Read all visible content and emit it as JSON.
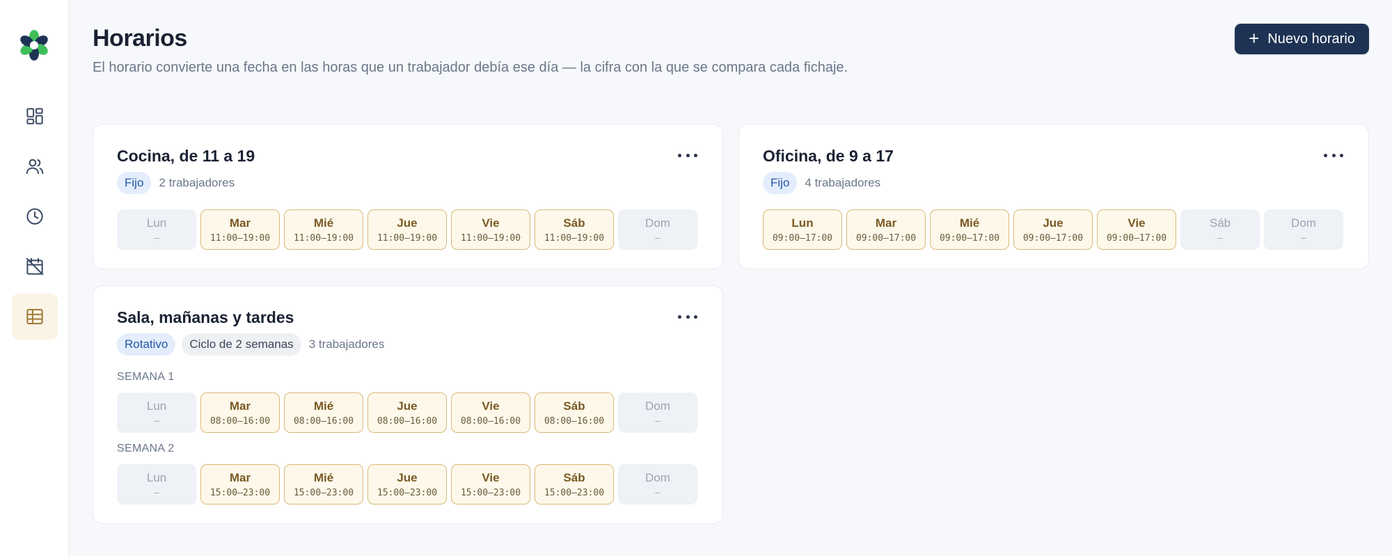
{
  "header": {
    "title": "Horarios",
    "subtitle": "El horario convierte una fecha en las horas que un trabajador debía ese día — la cifra con la que se compara cada fichaje.",
    "new_button": "Nuevo horario",
    "new_button_plus": "+"
  },
  "sidebar": {
    "items": [
      {
        "icon": "dashboard-icon",
        "active": false
      },
      {
        "icon": "users-icon",
        "active": false
      },
      {
        "icon": "clock-icon",
        "active": false
      },
      {
        "icon": "calendar-off-icon",
        "active": false
      },
      {
        "icon": "table-icon",
        "active": true
      }
    ]
  },
  "colors": {
    "accent": "#1e3354",
    "logo_green": "#3fbf5a",
    "logo_dark": "#1e3354",
    "day_on_border": "#d9b878",
    "day_on_bg": "#fdf8ea"
  },
  "schedules": [
    {
      "title": "Cocina, de 11 a 19",
      "type": "Fijo",
      "workers": "2 trabajadores",
      "days": [
        {
          "name": "Lun",
          "time": "–"
        },
        {
          "name": "Mar",
          "time": "11:00–19:00"
        },
        {
          "name": "Mié",
          "time": "11:00–19:00"
        },
        {
          "name": "Jue",
          "time": "11:00–19:00"
        },
        {
          "name": "Vie",
          "time": "11:00–19:00"
        },
        {
          "name": "Sáb",
          "time": "11:00–19:00"
        },
        {
          "name": "Dom",
          "time": "–"
        }
      ]
    },
    {
      "title": "Oficina, de 9 a 17",
      "type": "Fijo",
      "workers": "4 trabajadores",
      "days": [
        {
          "name": "Lun",
          "time": "09:00–17:00"
        },
        {
          "name": "Mar",
          "time": "09:00–17:00"
        },
        {
          "name": "Mié",
          "time": "09:00–17:00"
        },
        {
          "name": "Jue",
          "time": "09:00–17:00"
        },
        {
          "name": "Vie",
          "time": "09:00–17:00"
        },
        {
          "name": "Sáb",
          "time": "–"
        },
        {
          "name": "Dom",
          "time": "–"
        }
      ]
    },
    {
      "title": "Sala, mañanas y tardes",
      "type": "Rotativo",
      "cycle": "Ciclo de 2 semanas",
      "workers": "3 trabajadores",
      "weeks": [
        {
          "label": "SEMANA 1",
          "days": [
            {
              "name": "Lun",
              "time": "–"
            },
            {
              "name": "Mar",
              "time": "08:00–16:00"
            },
            {
              "name": "Mié",
              "time": "08:00–16:00"
            },
            {
              "name": "Jue",
              "time": "08:00–16:00"
            },
            {
              "name": "Vie",
              "time": "08:00–16:00"
            },
            {
              "name": "Sáb",
              "time": "08:00–16:00"
            },
            {
              "name": "Dom",
              "time": "–"
            }
          ]
        },
        {
          "label": "SEMANA 2",
          "days": [
            {
              "name": "Lun",
              "time": "–"
            },
            {
              "name": "Mar",
              "time": "15:00–23:00"
            },
            {
              "name": "Mié",
              "time": "15:00–23:00"
            },
            {
              "name": "Jue",
              "time": "15:00–23:00"
            },
            {
              "name": "Vie",
              "time": "15:00–23:00"
            },
            {
              "name": "Sáb",
              "time": "15:00–23:00"
            },
            {
              "name": "Dom",
              "time": "–"
            }
          ]
        }
      ]
    }
  ]
}
